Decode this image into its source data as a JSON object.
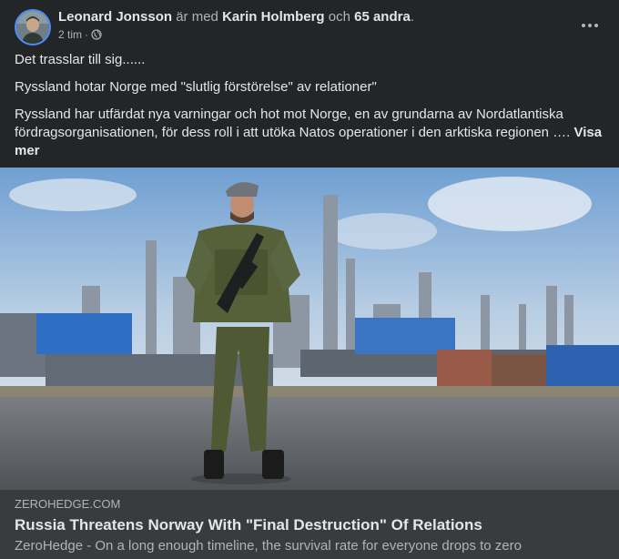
{
  "header": {
    "author": "Leonard Jonsson",
    "with_text": "är med",
    "tagged": "Karin Holmberg",
    "and_text": "och",
    "others": "65 andra",
    "period": ".",
    "time": "2 tim",
    "dot": "·",
    "privacy_icon": "globe-icon",
    "more_icon": "more-options-icon"
  },
  "post": {
    "line1": "Det trasslar till sig......",
    "line2": "Ryssland hotar Norge med \"slutlig förstörelse\" av relationer\"",
    "line3": "Ryssland har utfärdat nya varningar och hot mot Norge, en av grundarna av Nordatlantiska fördragsorganisationen, för dess roll i att utöka Natos operationer i den arktiska regionen ….",
    "see_more": "Visa mer"
  },
  "link_preview": {
    "domain": "ZEROHEDGE.COM",
    "title": "Russia Threatens Norway With \"Final Destruction\" Of Relations",
    "description": "ZeroHedge - On a long enough timeline, the survival rate for everyone drops to zero"
  },
  "colors": {
    "background": "#242526",
    "link_box": "#3a3b3c",
    "text_primary": "#e4e6eb",
    "text_secondary": "#b0b3b8",
    "avatar_ring": "#4b8cf7"
  }
}
